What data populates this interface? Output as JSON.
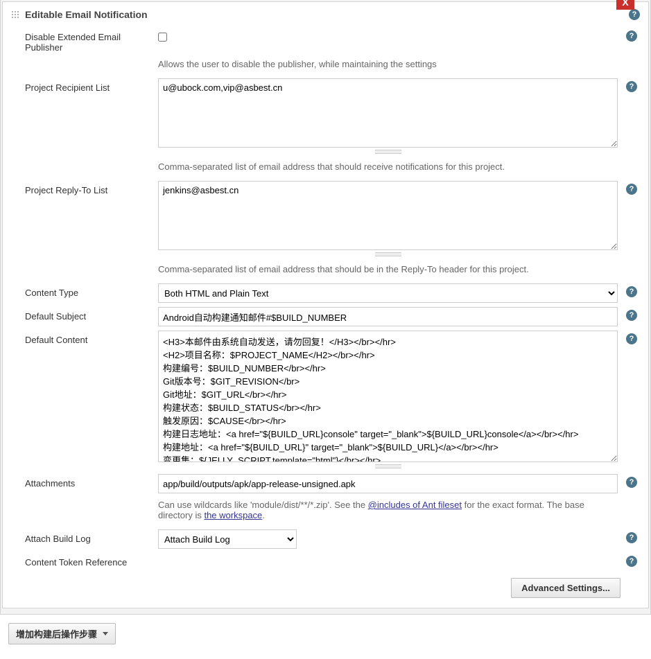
{
  "section": {
    "title": "Editable Email Notification",
    "close_label": "X"
  },
  "fields": {
    "disable_publisher": {
      "label": "Disable Extended Email Publisher",
      "desc": "Allows the user to disable the publisher, while maintaining the settings"
    },
    "recipient_list": {
      "label": "Project Recipient List",
      "value": "u@ubock.com,vip@asbest.cn",
      "desc": "Comma-separated list of email address that should receive notifications for this project."
    },
    "replyto_list": {
      "label": "Project Reply-To List",
      "value": "jenkins@asbest.cn",
      "desc": "Comma-separated list of email address that should be in the Reply-To header for this project."
    },
    "content_type": {
      "label": "Content Type",
      "selected": "Both HTML and Plain Text"
    },
    "default_subject": {
      "label": "Default Subject",
      "value": "Android自动构建通知邮件#$BUILD_NUMBER"
    },
    "default_content": {
      "label": "Default Content",
      "value": "<H3>本邮件由系统自动发送，请勿回复！</H3></br></hr>\n<H2>项目名称：$PROJECT_NAME</H2></br></hr>\n构建编号：$BUILD_NUMBER</br></hr>\nGit版本号：$GIT_REVISION</br>\nGit地址：$GIT_URL</br></hr>\n构建状态：$BUILD_STATUS</br></hr>\n触发原因：$CAUSE</br></hr>\n构建日志地址：<a href=\"${BUILD_URL}console\" target=\"_blank\">${BUILD_URL}console</a></br></hr>\n构建地址：<a href=\"${BUILD_URL}\" target=\"_blank\">${BUILD_URL}</a></br></hr>\n变更集：${JELLY_SCRIPT,template=\"html\"}</br></hr>"
    },
    "attachments": {
      "label": "Attachments",
      "value": "app/build/outputs/apk/app-release-unsigned.apk",
      "desc_pre": "Can use wildcards like 'module/dist/**/*.zip'. See the ",
      "desc_link1": "@includes of Ant fileset",
      "desc_mid": " for the exact format. The base directory is ",
      "desc_link2": "the workspace",
      "desc_post": "."
    },
    "attach_log": {
      "label": "Attach Build Log",
      "selected": "Attach Build Log"
    },
    "token_ref": {
      "label": "Content Token Reference"
    }
  },
  "buttons": {
    "advanced": "Advanced Settings...",
    "add_postbuild": "增加构建后操作步骤"
  }
}
